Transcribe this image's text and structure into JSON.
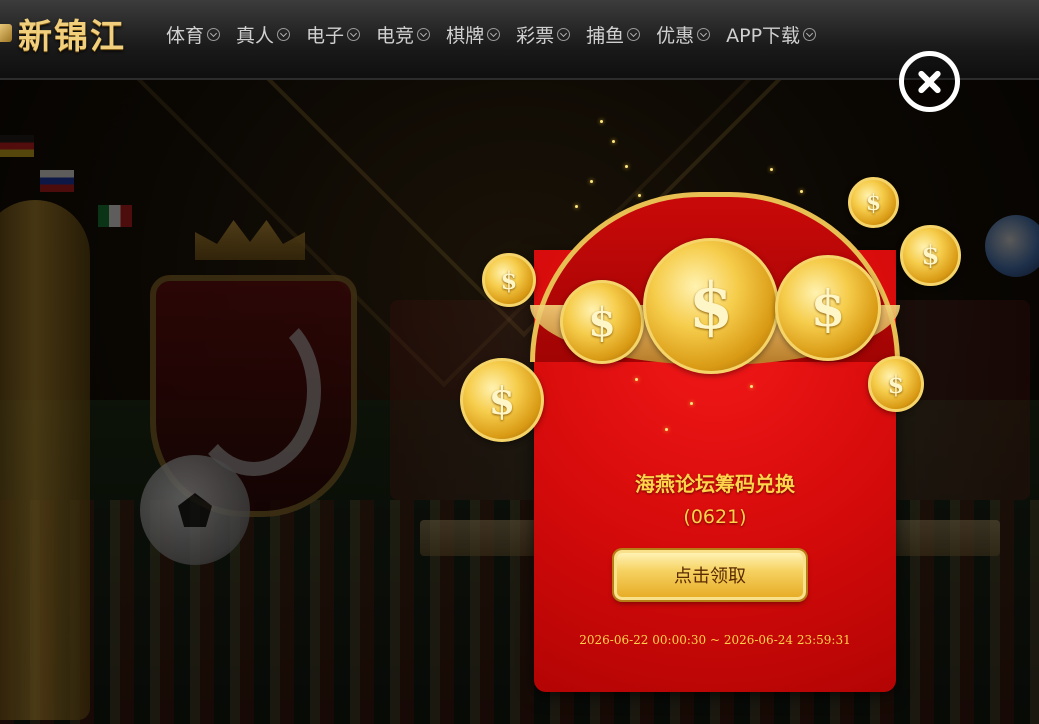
{
  "header": {
    "logo_text": "新锦江",
    "nav_items": [
      {
        "label": "体育",
        "icon": "chevron-down-icon"
      },
      {
        "label": "真人",
        "icon": "chevron-down-icon"
      },
      {
        "label": "电子",
        "icon": "chevron-down-icon"
      },
      {
        "label": "电竞",
        "icon": "chevron-down-icon"
      },
      {
        "label": "棋牌",
        "icon": "chevron-down-icon"
      },
      {
        "label": "彩票",
        "icon": "chevron-down-icon"
      },
      {
        "label": "捕鱼",
        "icon": "chevron-down-icon"
      },
      {
        "label": "优惠",
        "icon": "chevron-down-icon"
      },
      {
        "label": "APP下载",
        "icon": "chevron-down-icon"
      }
    ]
  },
  "popup": {
    "title": "海燕论坛筹码兑换",
    "code": "(0621)",
    "claim_button_label": "点击领取",
    "validity": "2026-06-22 00:00:30 ~ 2026-06-24 23:59:31",
    "close_icon": "close-icon",
    "coin_symbol": "$"
  },
  "colors": {
    "envelope_red": "#d40a0a",
    "gold_text": "#ffd34a",
    "nav_text": "#d0d0d0",
    "logo_gold": "#f1cf7c"
  }
}
